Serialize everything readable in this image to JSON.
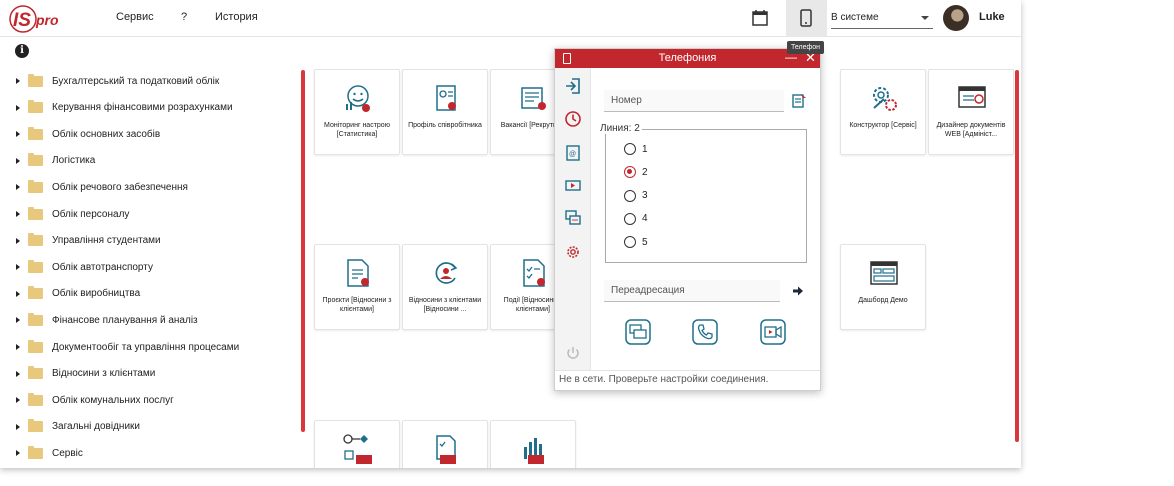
{
  "header": {
    "logo_text": "ISpro",
    "menu": [
      "Сервис",
      "?",
      "История"
    ],
    "status_value": "В системе",
    "user_name": "Luke",
    "tooltip": "Телефон"
  },
  "tree": {
    "items": [
      "Бухгалтерський та податковий облік",
      "Керування фінансовими розрахунками",
      "Облік основних засобів",
      "Логістика",
      "Облік речового забезпечення",
      "Облік персоналу",
      "Управління студентами",
      "Облік автотранспорту",
      "Облік виробництва",
      "Фінансове планування й аналіз",
      "Документообіг та управління процесами",
      "Відносини з клієнтами",
      "Облік комунальних послуг",
      "Загальні довідники",
      "Сервіс"
    ]
  },
  "tiles": [
    {
      "label": "Моніторинг настрою [Статистика]",
      "icon": "mood-monitor-icon"
    },
    {
      "label": "Профіль співробітника",
      "icon": "employee-profile-icon"
    },
    {
      "label": "Вакансії [Рекрутинг]",
      "icon": "vacancies-icon"
    },
    {
      "label": "Конструктор [Сервіс]",
      "icon": "gears-icon"
    },
    {
      "label": "Дизайнер документів WEB [Адмініст...",
      "icon": "doc-designer-icon"
    },
    {
      "label": "Проєкти [Відносини з клієнтами]",
      "icon": "projects-icon"
    },
    {
      "label": "Відносини з клієнтами [Відносини ...",
      "icon": "client-relations-icon"
    },
    {
      "label": "Події [Відносини з клієнтами]",
      "icon": "events-icon"
    },
    {
      "label": "Дашборд Демо",
      "icon": "dashboard-icon"
    },
    {
      "label": "",
      "icon": "bpm-flow-icon"
    },
    {
      "label": "",
      "icon": "bpm-doc-icon"
    },
    {
      "label": "",
      "icon": "bpm-chart-icon"
    }
  ],
  "telephony": {
    "title": "Телефония",
    "number_placeholder": "Номер",
    "lines_legend": "Линия: 2",
    "lines": [
      "1",
      "2",
      "3",
      "4",
      "5"
    ],
    "selected_line": "2",
    "redirect_placeholder": "Переадресация",
    "status_text": "Не в сети. Проверьте настройки соединения."
  },
  "colors": {
    "accent": "#c1272d",
    "icon_blue": "#1f6f8b",
    "folder": "#e8c87d"
  }
}
